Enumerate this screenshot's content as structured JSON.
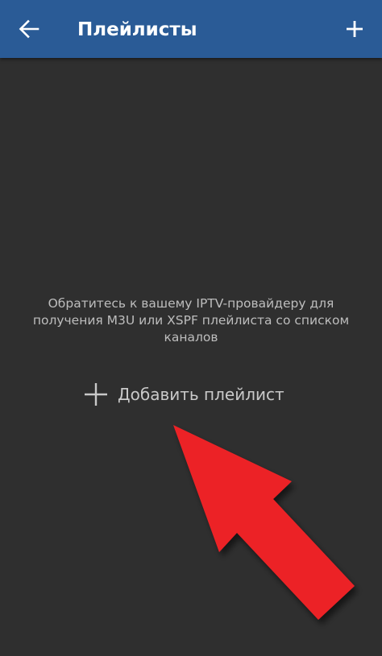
{
  "header": {
    "title": "Плейлисты",
    "back_icon": "arrow-left-icon",
    "add_icon": "plus-icon"
  },
  "empty_state": {
    "message": "Обратитесь к вашему IPTV-провайдеру для получения M3U или XSPF плейлиста со списком каналов",
    "add_label": "Добавить плейлист",
    "add_icon": "plus-icon"
  },
  "annotation": {
    "arrow_icon": "red-arrow-icon",
    "arrow_color": "#ec2227"
  },
  "colors": {
    "appbar": "#2a5b96",
    "background": "#2f2f2f",
    "text_secondary": "#bdbdbd"
  }
}
